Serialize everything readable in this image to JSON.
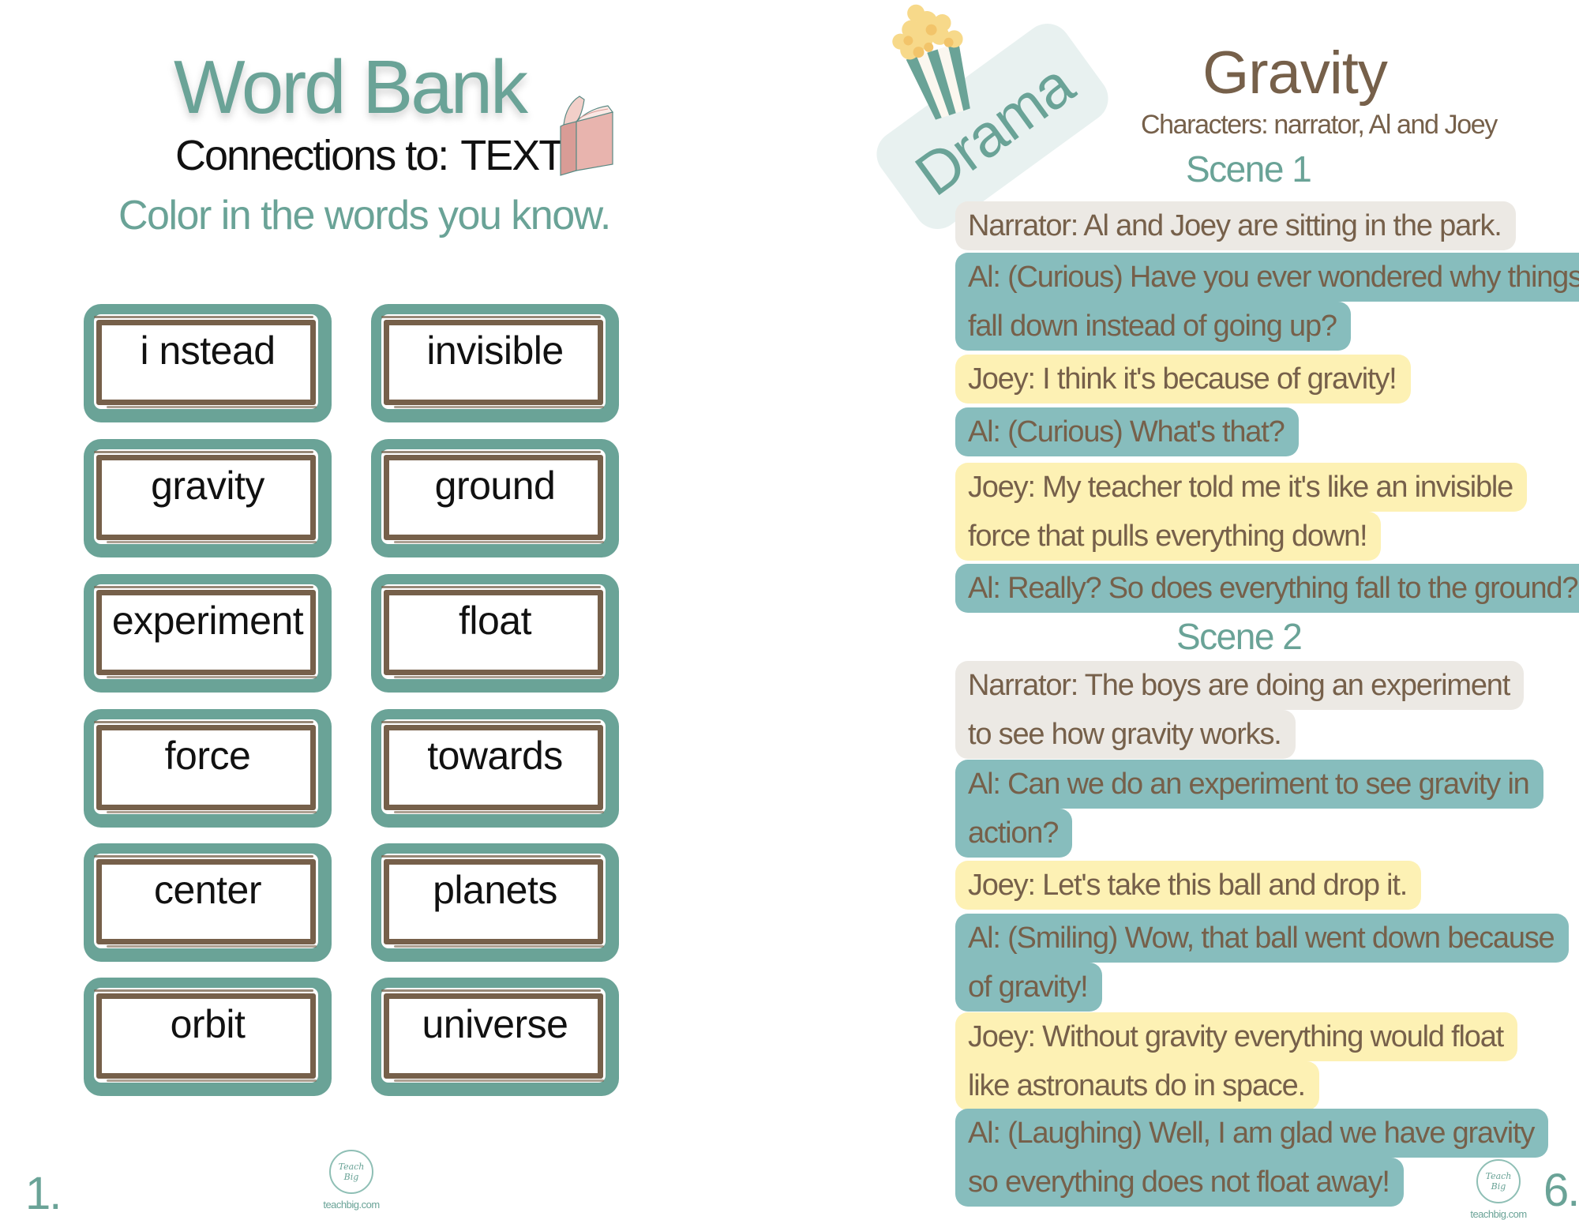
{
  "colors": {
    "teal": "#6aa397",
    "brown": "#76604a",
    "al_bubble": "#87bdbd",
    "joey_bubble": "#fdf1b4",
    "narrator_bubble": "#ece9e4",
    "drama_badge": "#e8f1f0",
    "book_pink": "#e8b4ae"
  },
  "left_page": {
    "title": "Word Bank",
    "subtitle_prefix": "Connections to:",
    "subtitle_focus": "TEXT",
    "subtitle_icon": "book-icon",
    "instructions": "Color in the words you know.",
    "words": [
      "i nstead",
      "invisible",
      "gravity",
      "ground",
      "experiment",
      "float",
      "force",
      "towards",
      "center",
      "planets",
      "orbit",
      "universe"
    ],
    "page_number": "1.",
    "logo": {
      "mark": "Teach Big",
      "url": "teachbig.com"
    }
  },
  "right_page": {
    "badge": "Drama",
    "badge_icon": "popcorn-icon",
    "title": "Gravity",
    "characters": "Characters: narrator, Al and Joey",
    "scenes": [
      {
        "label": "Scene 1",
        "lines": [
          {
            "speaker": "narrator",
            "text": [
              "Narrator: Al and Joey are sitting in the park."
            ]
          },
          {
            "speaker": "al",
            "text": [
              "Al: (Curious) Have you ever wondered why things",
              "fall down instead of going up?"
            ]
          },
          {
            "speaker": "joey",
            "text": [
              "Joey: I think it's because of gravity!"
            ]
          },
          {
            "speaker": "al",
            "text": [
              "Al: (Curious) What's that?"
            ]
          },
          {
            "speaker": "joey",
            "text": [
              "Joey: My teacher told me it's like an invisible",
              "force that pulls everything down!"
            ]
          },
          {
            "speaker": "al",
            "text": [
              "Al: Really? So does everything fall to the ground?"
            ]
          }
        ]
      },
      {
        "label": "Scene 2",
        "lines": [
          {
            "speaker": "narrator",
            "text": [
              "Narrator: The boys are doing an experiment",
              "to see how gravity works."
            ]
          },
          {
            "speaker": "al",
            "text": [
              "Al: Can we do an experiment to see gravity in",
              "action?"
            ]
          },
          {
            "speaker": "joey",
            "text": [
              "Joey: Let's take this ball and drop it."
            ]
          },
          {
            "speaker": "al",
            "text": [
              "Al: (Smiling) Wow, that ball went down because",
              "of gravity!"
            ]
          },
          {
            "speaker": "joey",
            "text": [
              "Joey: Without gravity everything would float",
              "like astronauts do in space."
            ]
          },
          {
            "speaker": "al",
            "text": [
              "Al: (Laughing) Well, I am glad we have gravity",
              "so everything does not float away!"
            ]
          }
        ]
      }
    ],
    "page_number": "6.",
    "logo": {
      "mark": "Teach Big",
      "url": "teachbig.com"
    }
  }
}
